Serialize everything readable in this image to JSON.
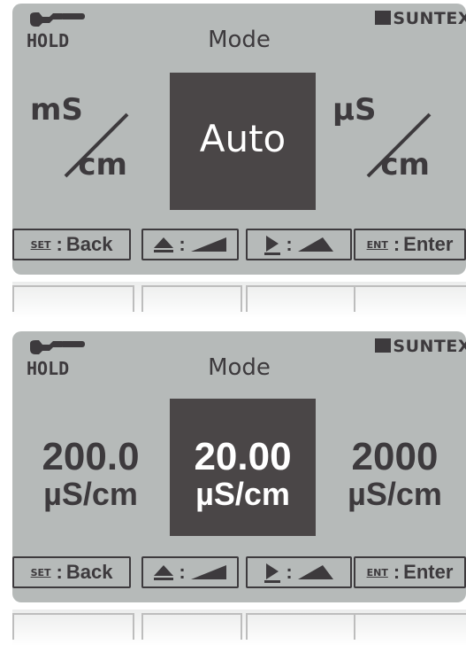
{
  "panels": [
    {
      "hold_label": "HOLD",
      "brand": "SUNTEX",
      "title": "Mode",
      "left_option": {
        "num": "mS",
        "den": "cm"
      },
      "selected_option": "Auto",
      "right_option": {
        "num": "µS",
        "den": "cm"
      },
      "keys": {
        "set_tag": "SET",
        "back_label": "Back",
        "up_symbol": "▲",
        "right_symbol": "▶",
        "enter_tag": "ENT",
        "enter_label": "Enter",
        "separator": ":"
      }
    },
    {
      "hold_label": "HOLD",
      "brand": "SUNTEX",
      "title": "Mode",
      "left_option": {
        "value": "200.0",
        "unit": "µS/cm"
      },
      "selected_option": {
        "value": "20.00",
        "unit": "µS/cm"
      },
      "right_option": {
        "value": "2000",
        "unit": "µS/cm"
      },
      "keys": {
        "set_tag": "SET",
        "back_label": "Back",
        "up_symbol": "▲",
        "right_symbol": "▶",
        "enter_tag": "ENT",
        "enter_label": "Enter",
        "separator": ":"
      }
    }
  ],
  "colors": {
    "lcd_background": "#b6bab9",
    "lcd_foreground": "#3d3a3d",
    "selection": "#4a4647"
  }
}
